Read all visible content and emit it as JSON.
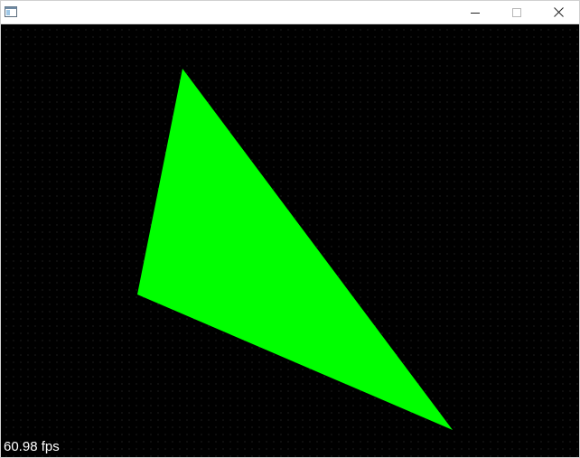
{
  "window": {
    "title": "",
    "controls": {
      "minimize": "minimize-icon",
      "maximize": "maximize-icon",
      "close": "close-icon"
    }
  },
  "scene": {
    "background_color": "#000000",
    "triangle_color": "#00ff00"
  },
  "hud": {
    "fps": "60.98 fps"
  }
}
